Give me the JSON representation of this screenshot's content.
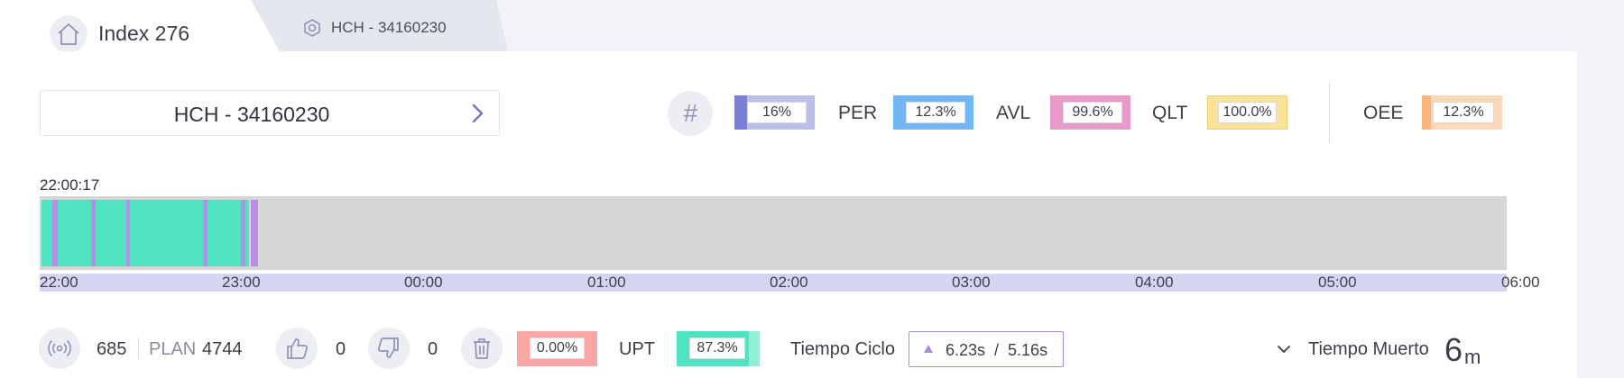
{
  "tabs": [
    {
      "label": "Index 276",
      "icon": "home-icon"
    },
    {
      "label": "HCH - 34160230",
      "icon": "hexagon-nut-icon"
    }
  ],
  "selector": {
    "label": "HCH - 34160230"
  },
  "kpis": {
    "count": {
      "value": "16%",
      "color": "#bcbfe9",
      "strip": "#7b7fd6"
    },
    "per": {
      "label": "PER",
      "value": "12.3%",
      "color": "#73b6f5"
    },
    "avl": {
      "label": "AVL",
      "value": "99.6%",
      "color": "#e89ac9"
    },
    "qlt": {
      "label": "QLT",
      "value": "100.0%",
      "color": "#fbe29a"
    },
    "oee": {
      "label": "OEE",
      "value": "12.3%",
      "color": "#fcd8b8",
      "strip": "#fbb47c"
    }
  },
  "timeline": {
    "start_time": "22:00:17",
    "ticks": [
      "22:00",
      "23:00",
      "00:00",
      "01:00",
      "02:00",
      "03:00",
      "04:00",
      "05:00",
      "06:00"
    ],
    "colors": {
      "running": "#4fe3c1",
      "stop": "#b98ee8",
      "idle": "#d6d6d6",
      "axis": "#d6d5f1"
    }
  },
  "bottom": {
    "produced": "685",
    "plan_label": "PLAN",
    "plan": "4744",
    "good": "0",
    "bad": "0",
    "scrap_pct": "0.00%",
    "upt_label": "UPT",
    "upt_value": "87.3%",
    "cycle_label": "Tiempo Ciclo",
    "cycle_value": "6.23s  /  5.16s",
    "dead_label": "Tiempo Muerto",
    "dead_value": "6",
    "dead_unit": "m"
  }
}
